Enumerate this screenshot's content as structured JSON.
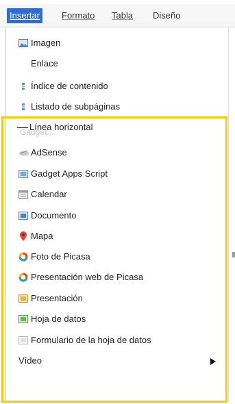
{
  "menubar": {
    "items": [
      {
        "label": "Insertar",
        "active": true
      },
      {
        "label": "Formato",
        "active": false
      },
      {
        "label": "Tabla",
        "active": false
      },
      {
        "label": "Diseño",
        "active": false
      }
    ]
  },
  "dropdown": {
    "top_items": [
      {
        "label": "Imagen",
        "icon": "image-icon"
      },
      {
        "label": "Enlace",
        "icon": ""
      },
      {
        "label": "Índice de contenido",
        "icon": "toc-icon"
      },
      {
        "label": "Listado de subpáginas",
        "icon": "subpages-icon"
      },
      {
        "label": "Línea horizontal",
        "icon": "horizontal-line-icon"
      }
    ],
    "gadgets_label": "Gadget...",
    "gadget_items": [
      {
        "label": "AdSense",
        "icon": "adsense-icon"
      },
      {
        "label": "Gadget Apps Script",
        "icon": "apps-script-icon"
      },
      {
        "label": "Calendar",
        "icon": "calendar-icon"
      },
      {
        "label": "Documento",
        "icon": "document-icon"
      },
      {
        "label": "Mapa",
        "icon": "map-pin-icon"
      },
      {
        "label": "Foto de Picasa",
        "icon": "picasa-icon"
      },
      {
        "label": "Presentación web de Picasa",
        "icon": "picasa-icon"
      },
      {
        "label": "Presentación",
        "icon": "presentation-icon"
      },
      {
        "label": "Hoja de datos",
        "icon": "spreadsheet-icon"
      },
      {
        "label": "Formulario de la hoja de datos",
        "icon": "form-icon"
      },
      {
        "label": "Vídeo",
        "icon": "",
        "submenu": true
      }
    ]
  },
  "colors": {
    "active_menu_bg": "#2f6fd3",
    "highlight_border": "#f5cc00"
  }
}
